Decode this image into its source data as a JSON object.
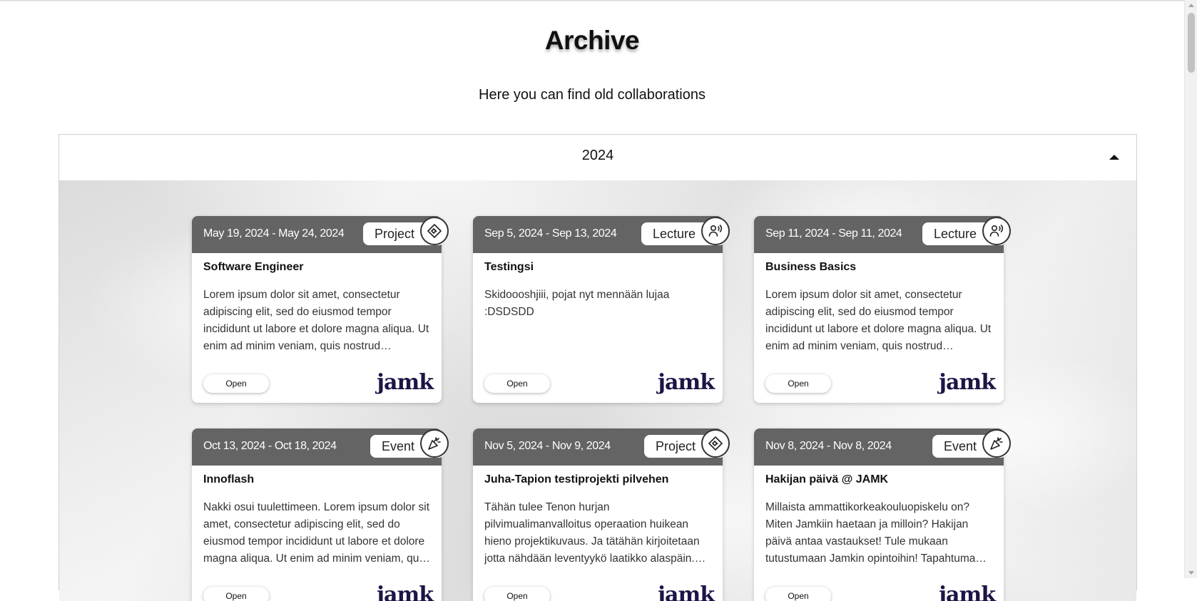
{
  "page": {
    "title": "Archive",
    "subtitle": "Here you can find old collaborations"
  },
  "accordion": {
    "year": "2024",
    "expanded": true
  },
  "cards": [
    {
      "date": "May 19, 2024 - May 24, 2024",
      "type": "Project",
      "icon": "handshake-icon",
      "name": "Software Engineer",
      "description": "Lorem ipsum dolor sit amet, consectetur adipiscing elit, sed do eiusmod tempor incididunt ut labore et dolore magna aliqua. Ut enim ad minim veniam, quis nostrud…",
      "button": "Open",
      "logo": "jamk"
    },
    {
      "date": "Sep 5, 2024 - Sep 13, 2024",
      "type": "Lecture",
      "icon": "speaker-icon",
      "name": "Testingsi",
      "description": "Skidoooshjiii, pojat nyt mennään lujaa :DSDSDD",
      "button": "Open",
      "logo": "jamk"
    },
    {
      "date": "Sep 11, 2024 - Sep 11, 2024",
      "type": "Lecture",
      "icon": "speaker-icon",
      "name": "Business Basics",
      "description": "Lorem ipsum dolor sit amet, consectetur adipiscing elit, sed do eiusmod tempor incididunt ut labore et dolore magna aliqua. Ut enim ad minim veniam, quis nostrud…",
      "button": "Open",
      "logo": "jamk"
    },
    {
      "date": "Oct 13, 2024 - Oct 18, 2024",
      "type": "Event",
      "icon": "party-popper-icon",
      "name": "Innoflash",
      "description": "Nakki osui tuulettimeen. Lorem ipsum dolor sit amet, consectetur adipiscing elit, sed do eiusmod tempor incididunt ut labore et dolore magna aliqua. Ut enim ad minim veniam, qu…",
      "button": "Open",
      "logo": "jamk"
    },
    {
      "date": "Nov 5, 2024 - Nov 9, 2024",
      "type": "Project",
      "icon": "handshake-icon",
      "name": "Juha-Tapion testiprojekti pilvehen",
      "description": "Tähän tulee Tenon hurjan pilvimualimanvalloitus operaation huikean hieno projektikuvaus. Ja tätähän kirjoitetaan jotta nähdään leventyykö laatikko alaspäin.…",
      "button": "Open",
      "logo": "jamk"
    },
    {
      "date": "Nov 8, 2024 - Nov 8, 2024",
      "type": "Event",
      "icon": "party-popper-icon",
      "name": "Hakijan päivä @ JAMK",
      "description": "Millaista ammattikorkeakouluopiskelu on? Miten Jamkiin haetaan ja milloin? Hakijan päivä antaa vastaukset! Tule mukaan tutustumaan Jamkin opintoihin! Tapahtuma…",
      "button": "Open",
      "logo": "jamk"
    }
  ]
}
